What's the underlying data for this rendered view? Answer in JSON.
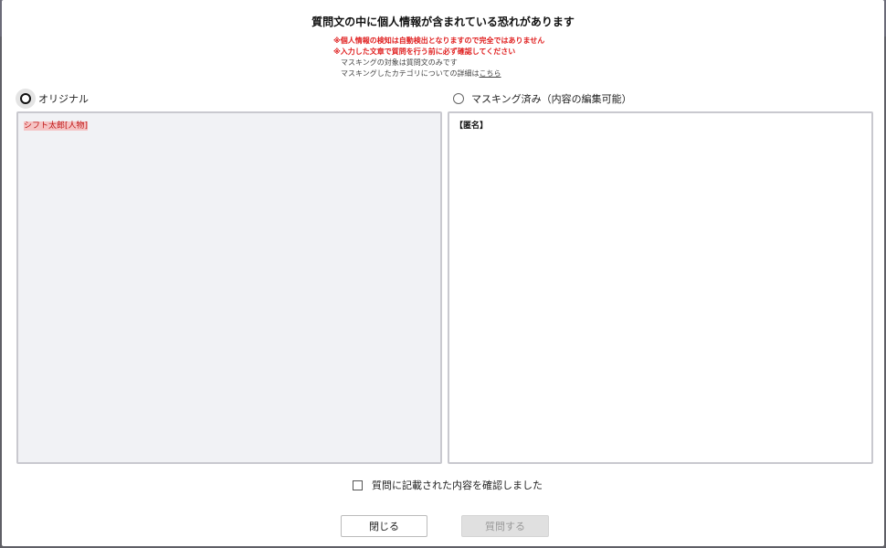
{
  "dialog": {
    "title": "質問文の中に個人情報が含まれている恐れがあります",
    "warnings": [
      "※個人情報の検知は自動検出となりますので完全ではありません",
      "※入力した文章で質問を行う前に必ず確認してください"
    ],
    "info_line_1": "マスキングの対象は質問文のみです",
    "info_line_2_prefix": "マスキングしたカテゴリについての詳細は",
    "info_line_2_link": "こちら"
  },
  "options": {
    "original": {
      "label": "オリジナル",
      "selected": true,
      "text": "シフト太郎[人物]"
    },
    "masked": {
      "label": "マスキング済み（内容の編集可能）",
      "selected": false,
      "text": "【匿名】"
    }
  },
  "confirm": {
    "label": "質問に記載された内容を確認しました",
    "checked": false
  },
  "buttons": {
    "close": "閉じる",
    "submit": "質問する"
  },
  "colors": {
    "warning": "#e02020",
    "highlight_bg": "#f5c4c4",
    "disabled_button": "#e0e0e0"
  }
}
